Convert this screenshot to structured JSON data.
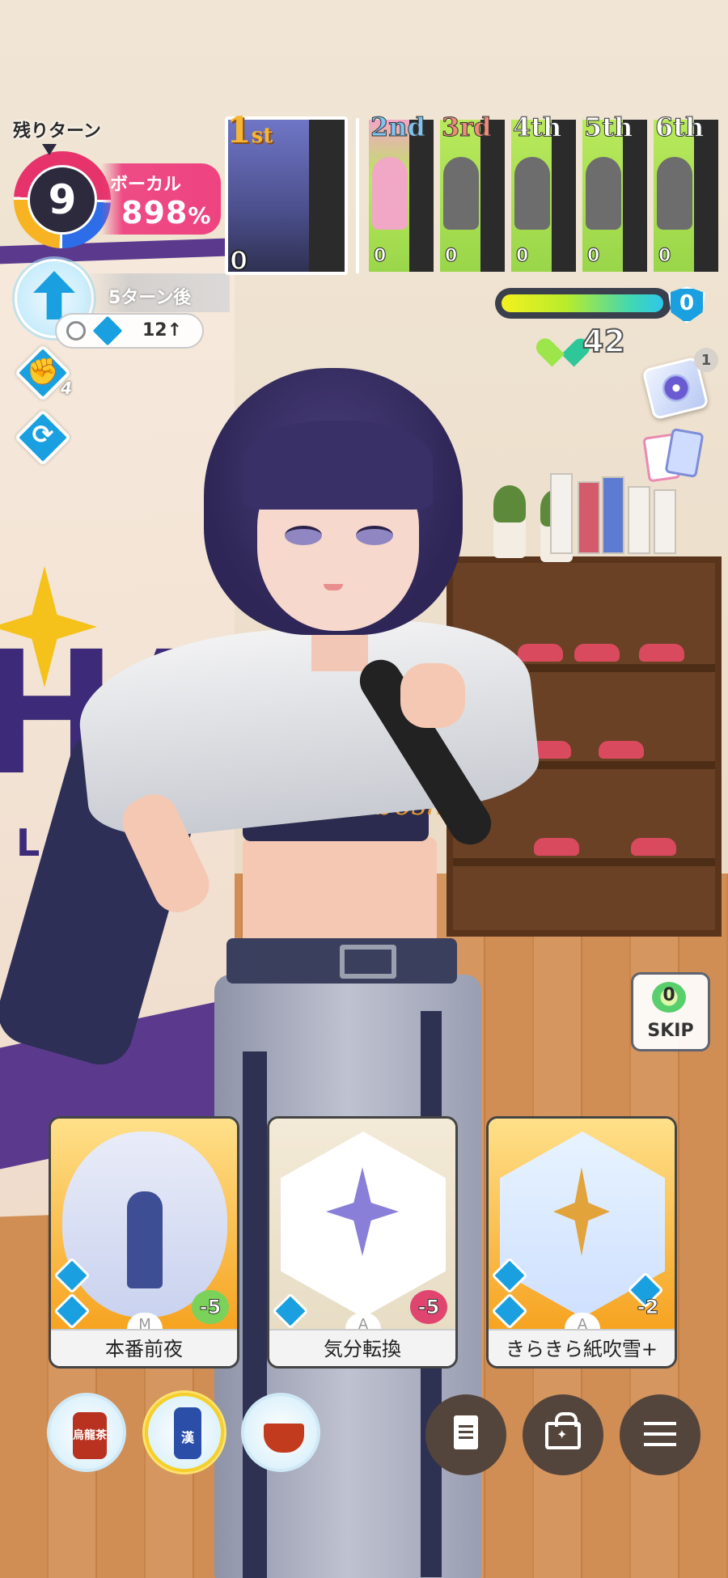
{
  "turns": {
    "label": "残りターン",
    "remaining": "9"
  },
  "parameter": {
    "label": "ボーカル",
    "value": "898",
    "unit": "%"
  },
  "boost": {
    "after_label": "5ターン後",
    "condition_value": "12↑",
    "icon": "up-arrow-icon"
  },
  "buffs": [
    {
      "icon": "fist-icon",
      "count": "4"
    },
    {
      "icon": "refresh-icon",
      "count": ""
    }
  ],
  "ranking": {
    "first": {
      "label": "1",
      "suffix": "st",
      "score": "0"
    },
    "others": [
      {
        "label": "2nd",
        "score": "0"
      },
      {
        "label": "3rd",
        "score": "0"
      },
      {
        "label": "4th",
        "score": "0"
      },
      {
        "label": "5th",
        "score": "0"
      },
      {
        "label": "6th",
        "score": "0"
      }
    ]
  },
  "gauge": {
    "shield_value": "0",
    "stamina": "42",
    "colors": [
      "#f4f01f",
      "#41d7b4",
      "#2ec7e8"
    ]
  },
  "side_items": {
    "disc_badge": "1",
    "disc_icon": "disc-item-icon",
    "cards_icon": "card-deck-icon"
  },
  "skip": {
    "cost": "0",
    "label": "SKIP"
  },
  "banner": {
    "letters": "HA",
    "sub": "L AUD"
  },
  "shirt_text": "Hatsuboshi",
  "cards": [
    {
      "name": "本番前夜",
      "rarity": "M",
      "cost": "-5"
    },
    {
      "name": "気分転換",
      "rarity": "A",
      "cost": "-5"
    },
    {
      "name": "きらきら紙吹雪+",
      "rarity": "A",
      "cost": "-2"
    }
  ],
  "drinks": [
    {
      "name": "oolong-tea",
      "label": "烏龍茶"
    },
    {
      "name": "energy-drink",
      "label": "漢"
    },
    {
      "name": "herbal-tea",
      "label": ""
    }
  ],
  "menu": {
    "log_icon": "document-icon",
    "item_icon": "bag-icon",
    "menu_icon": "hamburger-icon"
  }
}
